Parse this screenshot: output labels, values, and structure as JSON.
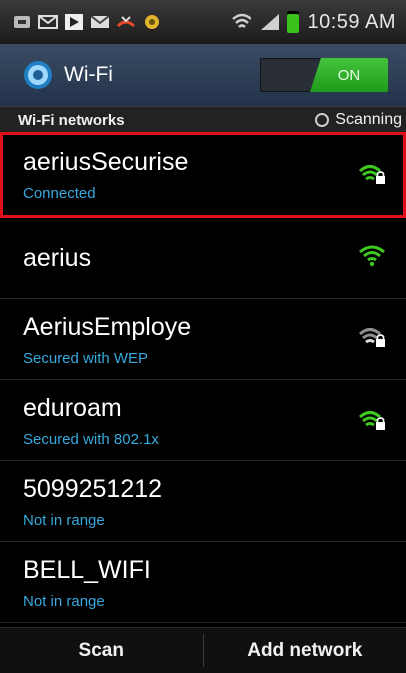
{
  "status_bar": {
    "time": "10:59 AM",
    "icons": [
      "notification-icon",
      "mail-icon",
      "play-store-icon",
      "gmail-icon",
      "missed-call-icon",
      "settings-icon",
      "wifi-icon",
      "signal-icon",
      "battery-icon"
    ]
  },
  "header": {
    "title": "Wi-Fi",
    "toggle_label": "ON"
  },
  "section": {
    "title": "Wi-Fi networks",
    "scanning_label": "Scanning"
  },
  "networks": [
    {
      "ssid": "aeriusSecurise",
      "status": "Connected",
      "secured": true,
      "signal": "strong"
    },
    {
      "ssid": "aerius",
      "status": "",
      "secured": false,
      "signal": "strong"
    },
    {
      "ssid": "AeriusEmploye",
      "status": "Secured with WEP",
      "secured": true,
      "signal": "weak"
    },
    {
      "ssid": "eduroam",
      "status": "Secured with 802.1x",
      "secured": true,
      "signal": "strong"
    },
    {
      "ssid": "5099251212",
      "status": "Not in range",
      "secured": false,
      "signal": "none"
    },
    {
      "ssid": "BELL_WIFI",
      "status": "Not in range",
      "secured": false,
      "signal": "none"
    }
  ],
  "bottom_bar": {
    "scan_label": "Scan",
    "add_network_label": "Add network"
  },
  "colors": {
    "accent_blue": "#38a9dd",
    "wifi_green": "#3fc81f",
    "toggle_on": "#2fb02a",
    "highlight_red": "#e10f1a"
  }
}
